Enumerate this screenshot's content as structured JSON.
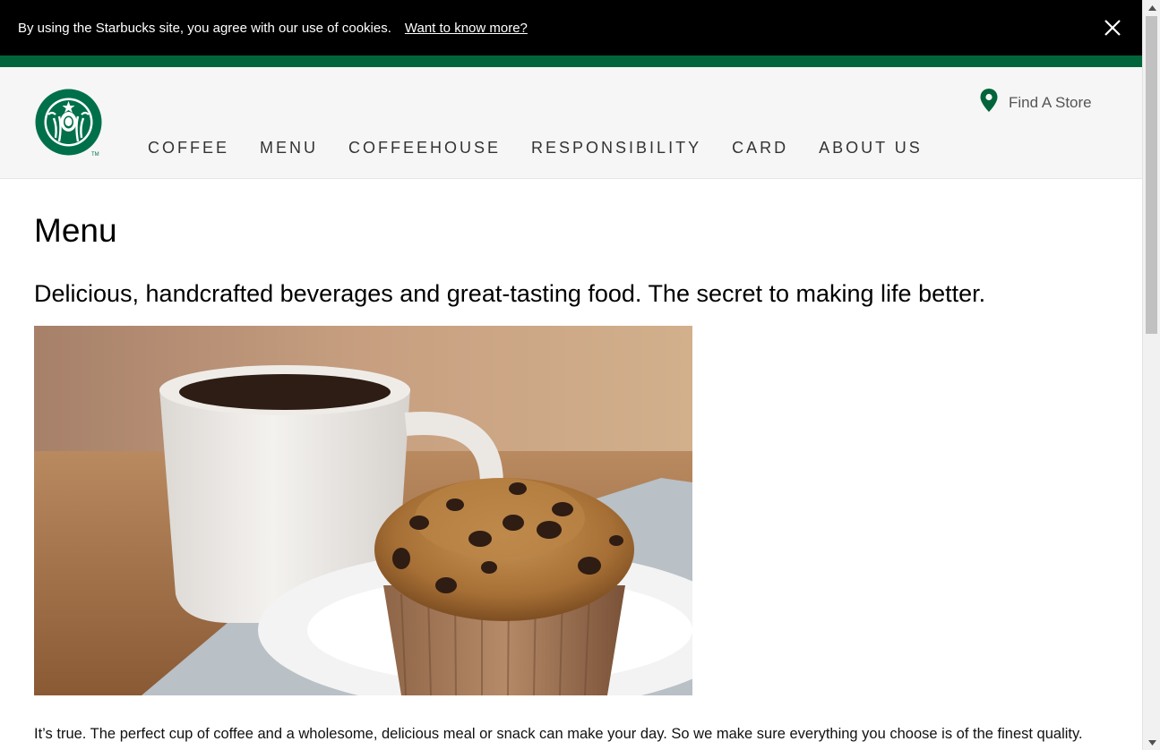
{
  "cookie_banner": {
    "text": "By using the Starbucks site, you agree with our use of cookies.",
    "link_label": "Want to know more?",
    "close_icon": "close-icon"
  },
  "header": {
    "logo_icon": "starbucks-siren-logo",
    "find_store": {
      "icon": "map-pin-icon",
      "label": "Find A Store"
    },
    "nav": [
      "COFFEE",
      "MENU",
      "COFFEEHOUSE",
      "RESPONSIBILITY",
      "CARD",
      "ABOUT US"
    ]
  },
  "main": {
    "title": "Menu",
    "tagline": "Delicious, handcrafted beverages and great-tasting food. The secret to making life better.",
    "hero_image": "coffee-mug-and-chocolate-chip-muffin-photo",
    "body": "It’s true. The perfect cup of coffee and a wholesome, delicious meal or snack can make your day. So we make sure everything you choose is of the finest quality."
  },
  "colors": {
    "brand_green": "#00653a",
    "banner_black": "#000000",
    "header_bg": "#f6f6f6"
  }
}
